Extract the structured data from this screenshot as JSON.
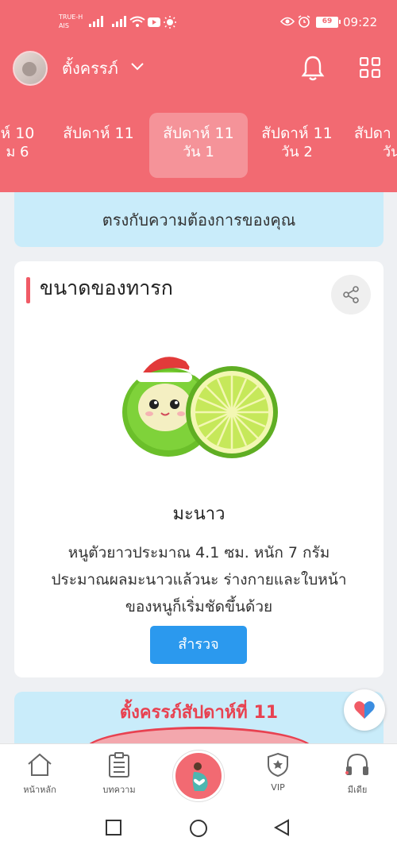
{
  "status_bar": {
    "carrier_line1": "TRUE-H",
    "carrier_line2": "AIS",
    "battery": "69",
    "time": "09:22"
  },
  "header": {
    "profile_name": "ตั้งครรภ์",
    "weeks": [
      {
        "line1": "ห์ 10",
        "line2": "ม 6"
      },
      {
        "line1": "สัปดาห์ 11",
        "line2": ""
      },
      {
        "line1": "สัปดาห์ 11",
        "line2": "วัน 1"
      },
      {
        "line1": "สัปดาห์ 11",
        "line2": "วัน 2"
      },
      {
        "line1": "สัปดา",
        "line2": "วัน"
      }
    ],
    "active_week_index": 2
  },
  "info_banner": {
    "text": "ตรงกับความต้องการของคุณ"
  },
  "baby_size_card": {
    "title": "ขนาดของทารก",
    "fruit_name": "มะนาว",
    "description_line1": "หนูตัวยาวประมาณ 4.1 ซม. หนัก 7 กรัม",
    "description_line2": "ประมาณผลมะนาวแล้วนะ ร่างกายและใบหน้า",
    "description_line3": "ของหนูก็เริ่มชัดขึ้นด้วย",
    "explore_button": "สำรวจ"
  },
  "promo": {
    "title": "ตั้งครรภ์สัปดาห์ที่ 11"
  },
  "bottom_nav": {
    "home": "หน้าหลัก",
    "articles": "บทความ",
    "vip": "VIP",
    "media": "มีเดีย"
  },
  "colors": {
    "header": "#f26a72",
    "accent": "#f05b66",
    "button": "#2b99ee",
    "banner": "#c9ecfa"
  }
}
